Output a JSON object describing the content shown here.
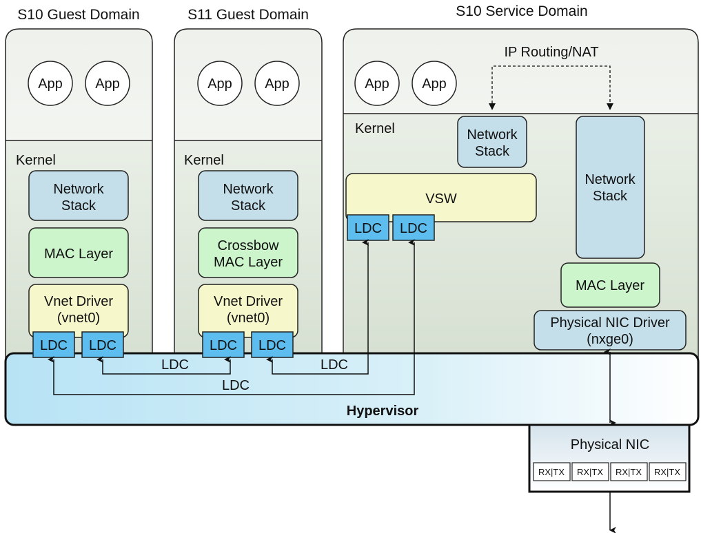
{
  "domains": [
    {
      "title": "S10 Guest Domain",
      "apps": [
        "App",
        "App"
      ],
      "kernel": "Kernel",
      "network_stack": [
        "Network",
        "Stack"
      ],
      "mac": [
        "MAC Layer"
      ],
      "driver": [
        "Vnet Driver",
        "(vnet0)"
      ],
      "ldcs": [
        "LDC",
        "LDC"
      ]
    },
    {
      "title": "S11 Guest Domain",
      "apps": [
        "App",
        "App"
      ],
      "kernel": "Kernel",
      "network_stack": [
        "Network",
        "Stack"
      ],
      "mac": [
        "Crossbow",
        "MAC Layer"
      ],
      "driver": [
        "Vnet Driver",
        "(vnet0)"
      ],
      "ldcs": [
        "LDC",
        "LDC"
      ]
    },
    {
      "title": "S10 Service Domain",
      "apps": [
        "App",
        "App"
      ],
      "kernel": "Kernel",
      "ip_routing": "IP Routing/NAT",
      "network_stack_small": [
        "Network",
        "Stack"
      ],
      "network_stack_big": [
        "Network",
        "Stack"
      ],
      "vsw": "VSW",
      "ldcs": [
        "LDC",
        "LDC"
      ],
      "mac": "MAC Layer",
      "nic_driver": [
        "Physical NIC Driver",
        "(nxge0)"
      ]
    }
  ],
  "hypervisor": {
    "label": "Hypervisor",
    "links": [
      "LDC",
      "LDC",
      "LDC"
    ]
  },
  "physical_nic": {
    "label": "Physical NIC",
    "rings": [
      "RX|TX",
      "RX|TX",
      "RX|TX",
      "RX|TX"
    ]
  },
  "colors": {
    "stack": "#c4dfea",
    "mac": "#ccf5cc",
    "driver": "#f6f8cc",
    "ldc": "#5cbdee",
    "hypervisor": "#bfe6f5"
  }
}
